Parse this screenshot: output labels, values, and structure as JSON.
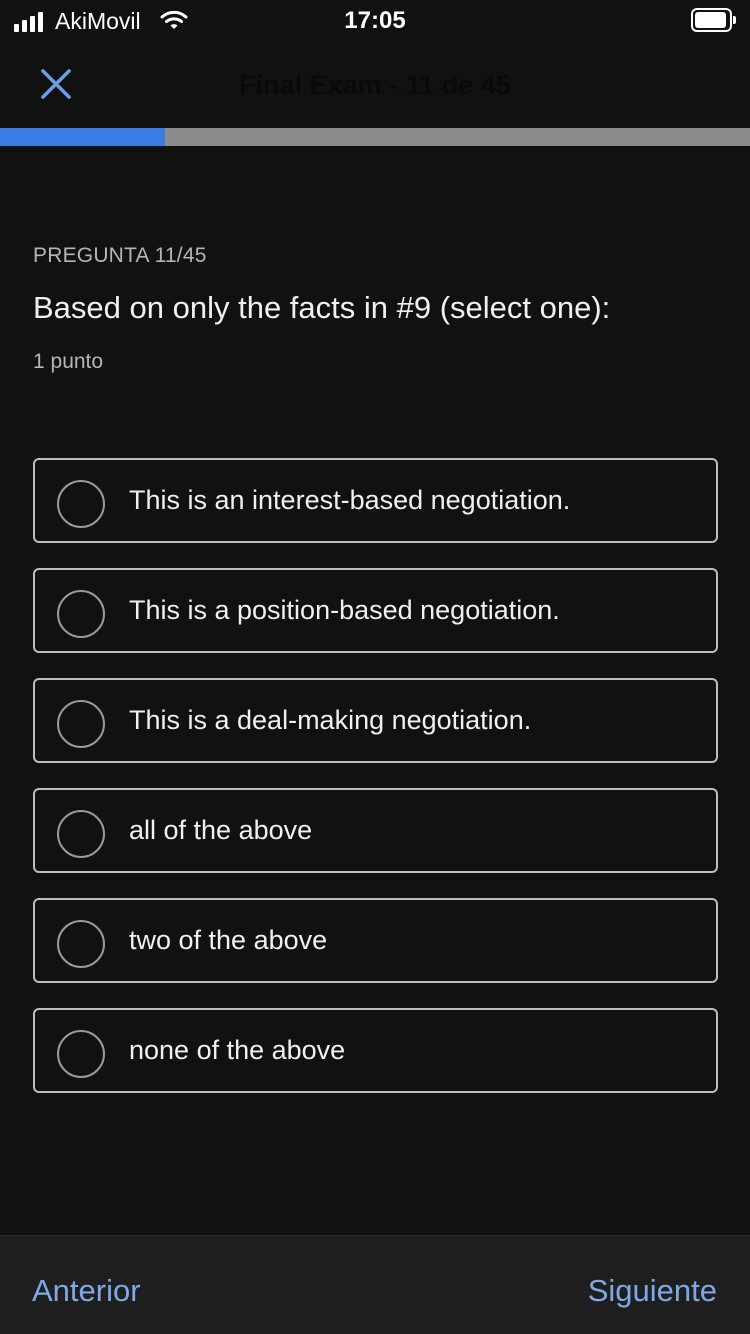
{
  "status_bar": {
    "carrier": "AkiMovil",
    "time": "17:05",
    "signal_bars": 4,
    "battery_icon": "battery-full-icon"
  },
  "header": {
    "title": "Final Exam - 11 de 45",
    "close_icon": "close-icon",
    "accent_color": "#3a7de4"
  },
  "progress": {
    "current": 11,
    "total": 45,
    "fraction": 0.22
  },
  "question": {
    "label": "PREGUNTA 11/45",
    "text": "Based on only the facts in #9 (select one):",
    "points": "1 punto",
    "options": [
      {
        "label": "This is an interest-based negotiation.",
        "selected": false
      },
      {
        "label": "This is a position-based negotiation.",
        "selected": false
      },
      {
        "label": "This is a deal-making negotiation.",
        "selected": false
      },
      {
        "label": "all of the above",
        "selected": false
      },
      {
        "label": "two of the above",
        "selected": false
      },
      {
        "label": "none of the above",
        "selected": false
      }
    ]
  },
  "footer": {
    "prev_label": "Anterior",
    "next_label": "Siguiente",
    "link_color": "#7ea8e6"
  }
}
